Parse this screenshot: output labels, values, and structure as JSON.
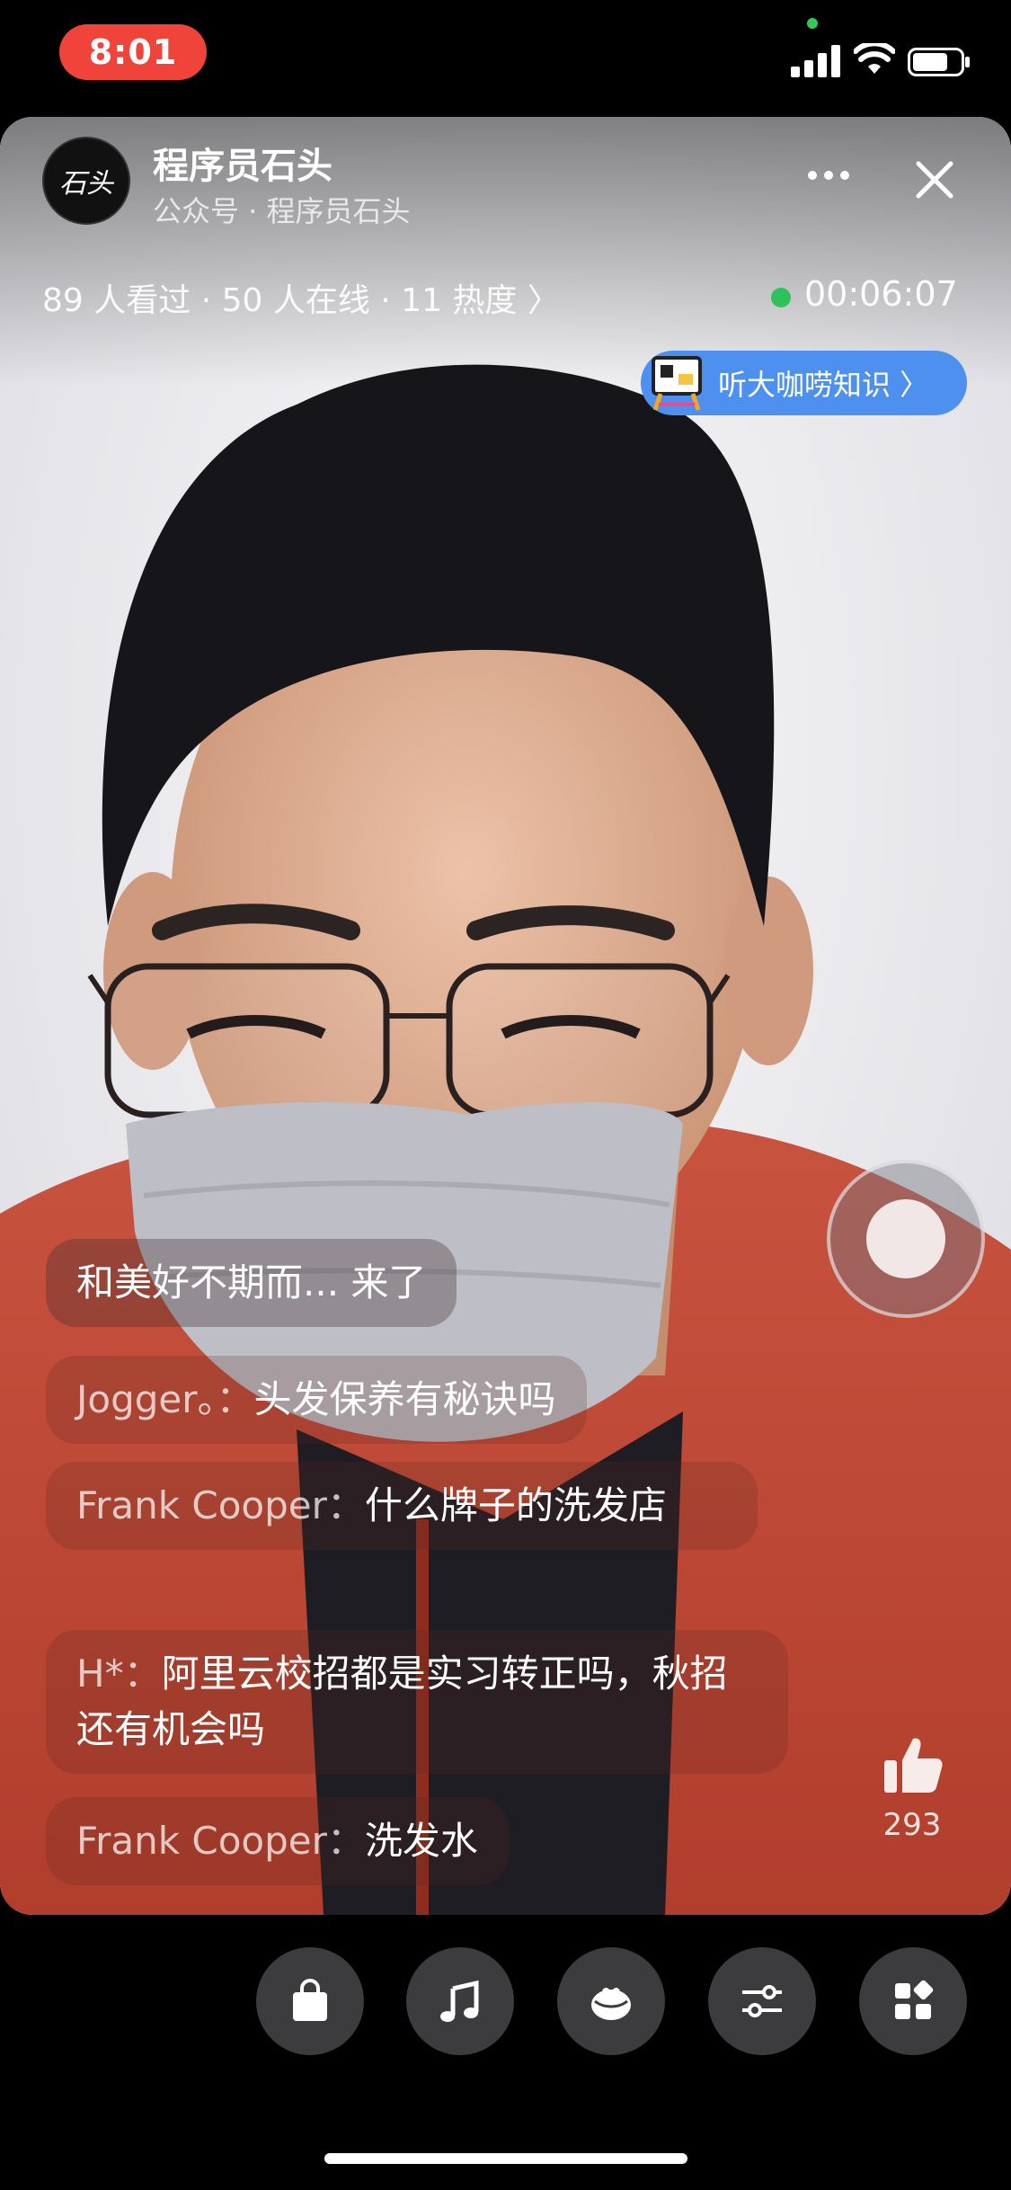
{
  "status_bar": {
    "time": "8:01",
    "icons": [
      "signal-icon",
      "wifi-icon",
      "battery-icon"
    ]
  },
  "header": {
    "avatar_text": "石头",
    "account_name": "程序员石头",
    "account_subtitle": "公众号 · 程序员石头",
    "more_icon": "more-dots-icon",
    "close_icon": "close-icon"
  },
  "stats": {
    "summary": "89 人看过 · 50 人在线 · 11 热度 〉",
    "duration": "00:06:07",
    "live_color": "#2fc15a"
  },
  "promo": {
    "label": "听大咖唠知识 〉",
    "color": "#4d90f0"
  },
  "comments": {
    "join_message": "和美好不期而... 来了",
    "items": [
      {
        "user": "Jogger。：",
        "text": "头发保养有秘诀吗"
      },
      {
        "user": "Frank Cooper：",
        "text": "什么牌子的洗发店"
      },
      {
        "user": "H*：",
        "text": "阿里云校招都是实习转正吗，秋招还有机会吗"
      },
      {
        "user": "Frank Cooper：",
        "text": "洗发水"
      }
    ]
  },
  "likes": {
    "count": "293"
  },
  "toolbar": {
    "buttons": [
      "shopping-bag-icon",
      "music-note-icon",
      "gift-icon",
      "sliders-icon",
      "apps-icon"
    ]
  },
  "colors": {
    "time_pill": "#f0433a",
    "toolbar_button": "#3c3c3e"
  }
}
